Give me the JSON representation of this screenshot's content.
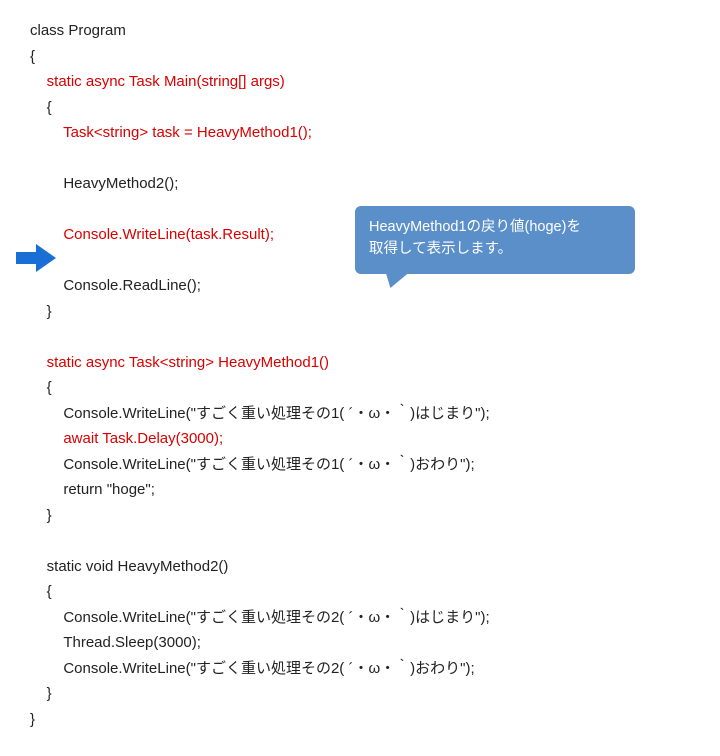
{
  "code": {
    "l01": "class Program",
    "l02": "{",
    "l03a": "    ",
    "l03b": "static async Task Main(string[] args)",
    "l04": "    {",
    "l05a": "        ",
    "l05b": "Task<string> task = HeavyMethod1();",
    "l06": "",
    "l07": "        HeavyMethod2();",
    "l08": "",
    "l09a": "        ",
    "l09b": "Console.WriteLine(task.Result);",
    "l10": "",
    "l11": "        Console.ReadLine();",
    "l12": "    }",
    "l13": "",
    "l14a": "    ",
    "l14b": "static async Task<string> HeavyMethod1()",
    "l15": "    {",
    "l16": "        Console.WriteLine(\"すごく重い処理その1( ´・ω・｀)はじまり\");",
    "l17a": "        ",
    "l17b": "await Task.Delay(3000);",
    "l18": "        Console.WriteLine(\"すごく重い処理その1( ´・ω・｀)おわり\");",
    "l19": "        return \"hoge\";",
    "l20": "    }",
    "l21": "",
    "l22": "    static void HeavyMethod2()",
    "l23": "    {",
    "l24": "        Console.WriteLine(\"すごく重い処理その2( ´・ω・｀)はじまり\");",
    "l25": "        Thread.Sleep(3000);",
    "l26": "        Console.WriteLine(\"すごく重い処理その2( ´・ω・｀)おわり\");",
    "l27": "    }",
    "l28": "}"
  },
  "callout": {
    "line1": "HeavyMethod1の戻り値(hoge)を",
    "line2": "取得して表示します。"
  }
}
